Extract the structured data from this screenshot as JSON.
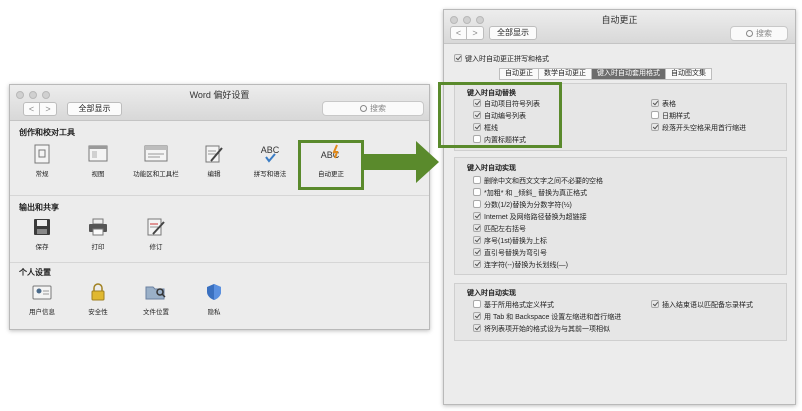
{
  "left_window": {
    "title": "Word 偏好设置",
    "nav_back": "<",
    "nav_forward": ">",
    "show_all": "全部显示",
    "search_placeholder": "搜索",
    "sections": [
      {
        "title": "创作和校对工具",
        "items": [
          {
            "label": "常规",
            "icon": "general-icon"
          },
          {
            "label": "视图",
            "icon": "view-icon"
          },
          {
            "label": "功能区和工具栏",
            "icon": "ribbon-icon"
          },
          {
            "label": "编辑",
            "icon": "edit-icon"
          },
          {
            "label": "拼写和语法",
            "icon": "spelling-icon",
            "icon_text": "ABC"
          },
          {
            "label": "自动更正",
            "icon": "autocorrect-icon",
            "icon_text": "ABC"
          }
        ]
      },
      {
        "title": "输出和共享",
        "items": [
          {
            "label": "保存",
            "icon": "save-icon"
          },
          {
            "label": "打印",
            "icon": "print-icon"
          },
          {
            "label": "修订",
            "icon": "track-changes-icon"
          }
        ]
      },
      {
        "title": "个人设置",
        "items": [
          {
            "label": "用户信息",
            "icon": "user-info-icon"
          },
          {
            "label": "安全性",
            "icon": "security-icon"
          },
          {
            "label": "文件位置",
            "icon": "file-locations-icon"
          },
          {
            "label": "隐私",
            "icon": "privacy-icon"
          }
        ]
      }
    ]
  },
  "right_window": {
    "title": "自动更正",
    "nav_back": "<",
    "nav_forward": ">",
    "show_all": "全部显示",
    "search_placeholder": "搜索",
    "top_checkbox": {
      "label": "键入时自动更正拼写和格式",
      "checked": true
    },
    "tabs": [
      {
        "label": "自动更正",
        "active": false
      },
      {
        "label": "数学自动更正",
        "active": false
      },
      {
        "label": "键入时自动套用格式",
        "active": true
      },
      {
        "label": "自动图文集",
        "active": false
      }
    ],
    "group1": {
      "title": "键入时自动替换",
      "left": [
        {
          "label": "自动项目符号列表",
          "checked": true
        },
        {
          "label": "自动编号列表",
          "checked": true
        },
        {
          "label": "框线",
          "checked": true
        },
        {
          "label": "内置标题样式",
          "checked": false
        }
      ],
      "right": [
        {
          "label": "表格",
          "checked": true
        },
        {
          "label": "日期样式",
          "checked": false
        },
        {
          "label": "段落开头空格采用首行缩进",
          "checked": true
        }
      ]
    },
    "group2": {
      "title": "键入时自动实现",
      "items": [
        {
          "label": "删除中文和西文文字之间不必要的空格",
          "checked": false
        },
        {
          "label": "*加粗* 和 _倾斜_ 替换为真正格式",
          "checked": false
        },
        {
          "label": "分数(1/2)替换为分数字符(½)",
          "checked": false
        },
        {
          "label": "Internet 及网络路径替换为超链接",
          "checked": true
        },
        {
          "label": "匹配左右括号",
          "checked": true
        },
        {
          "label": "序号(1st)替换为上标",
          "checked": true
        },
        {
          "label": "直引号替换为弯引号",
          "checked": true
        },
        {
          "label": "连字符(--)替换为长划线(—)",
          "checked": true
        }
      ]
    },
    "group3": {
      "title": "键入时自动实现",
      "left": [
        {
          "label": "基于所用格式定义样式",
          "checked": false
        },
        {
          "label": "用 Tab 和 Backspace 设置左缩进和首行缩进",
          "checked": true
        },
        {
          "label": "将列表项开始的格式设为与其前一项相似",
          "checked": true
        }
      ],
      "right": [
        {
          "label": "插入结束语以匹配备忘录样式",
          "checked": true
        }
      ]
    }
  },
  "colors": {
    "highlight": "#5a8a2c",
    "arrow": "#5a8a2c",
    "active_tab": "#6d6d6d"
  }
}
